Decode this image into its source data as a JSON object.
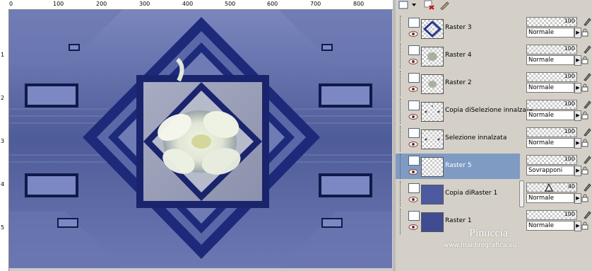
{
  "ruler": {
    "top_ticks": [
      "0",
      "100",
      "200",
      "300",
      "400",
      "500",
      "600",
      "700",
      "800"
    ],
    "left_ticks": [
      "1",
      "2",
      "3",
      "4",
      "5"
    ]
  },
  "canvas": {
    "description_colors": {
      "background": "#5a6aa6",
      "frame": "#1d2a7a",
      "accent": "#2a3a8a"
    }
  },
  "layers": [
    {
      "name": "Raster 3",
      "selected": false,
      "thumb": "diamond-frame"
    },
    {
      "name": "Raster 4",
      "selected": false,
      "thumb": "grey-blob"
    },
    {
      "name": "Raster 2",
      "selected": false,
      "thumb": "grey-blob"
    },
    {
      "name": "Copia diSelezione innalzata",
      "selected": false,
      "thumb": "dots"
    },
    {
      "name": "Selezione innalzata",
      "selected": false,
      "thumb": "dots"
    },
    {
      "name": "Raster 5",
      "selected": true,
      "thumb": "transparent"
    },
    {
      "name": "Copia diRaster 1",
      "selected": false,
      "thumb": "blue"
    },
    {
      "name": "Raster 1",
      "selected": false,
      "thumb": "blue"
    }
  ],
  "layer_props": [
    {
      "opacity": "100",
      "blend": "Normale"
    },
    {
      "opacity": "100",
      "blend": "Normale"
    },
    {
      "opacity": "100",
      "blend": "Normale"
    },
    {
      "opacity": "100",
      "blend": "Normale"
    },
    {
      "opacity": "100",
      "blend": "Normale"
    },
    {
      "opacity": "100",
      "blend": "Sovrapponi"
    },
    {
      "opacity": "40",
      "blend": "Normale"
    },
    {
      "opacity": "100",
      "blend": "Normale"
    }
  ],
  "watermark": {
    "name": "Pinuccia",
    "url": "www.maidiregrafica.eu"
  }
}
